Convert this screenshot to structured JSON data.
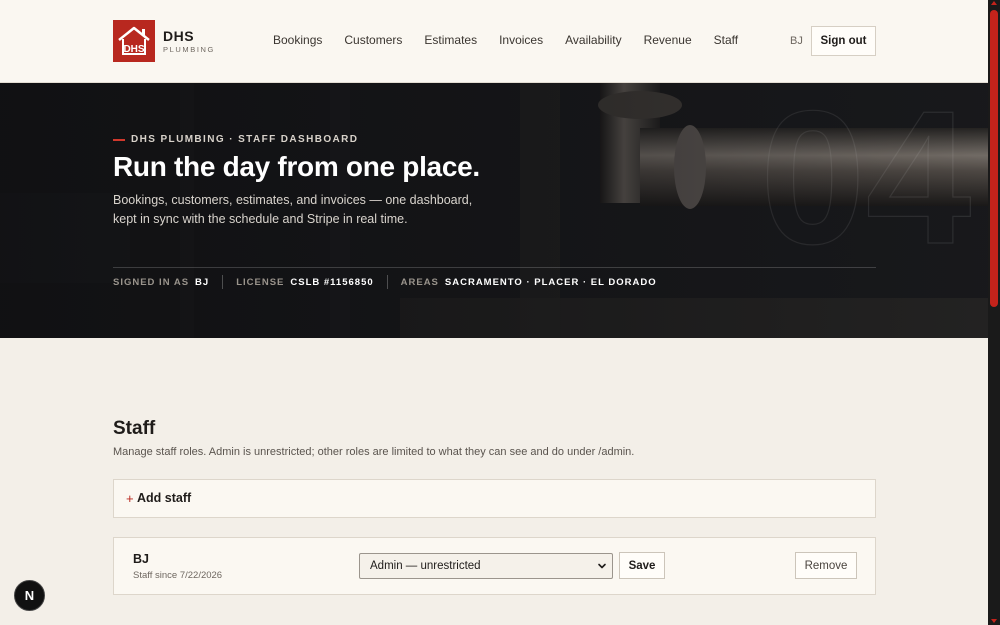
{
  "brand": {
    "name": "DHS",
    "subtitle": "PLUMBING",
    "logo_text": "DHS",
    "color": "#b8281f"
  },
  "nav": {
    "items": [
      {
        "label": "Bookings"
      },
      {
        "label": "Customers"
      },
      {
        "label": "Estimates"
      },
      {
        "label": "Invoices"
      },
      {
        "label": "Availability"
      },
      {
        "label": "Revenue"
      },
      {
        "label": "Staff"
      }
    ]
  },
  "header": {
    "user_initials": "BJ",
    "signout_label": "Sign out"
  },
  "hero": {
    "eyebrow": "DHS PLUMBING · STAFF DASHBOARD",
    "title": "Run the day from one place.",
    "description": "Bookings, customers, estimates, and invoices — one dashboard, kept in sync with the schedule and Stripe in real time.",
    "meta": {
      "signed_in_label": "SIGNED IN AS",
      "signed_in_value": "BJ",
      "license_label": "LICENSE",
      "license_value": "CSLB #1156850",
      "areas_label": "AREAS",
      "areas_value": "SACRAMENTO · PLACER · EL DORADO"
    }
  },
  "staff": {
    "title": "Staff",
    "description": "Manage staff roles. Admin is unrestricted; other roles are limited to what they can see and do under /admin.",
    "add_plus": "+",
    "add_label": "Add staff",
    "members": [
      {
        "name": "BJ",
        "since": "Staff since 7/22/2026",
        "role": "Admin — unrestricted",
        "save_label": "Save",
        "remove_label": "Remove"
      }
    ]
  },
  "dev_badge": {
    "letter": "N"
  },
  "colors": {
    "accent": "#b8281f",
    "background": "#f3efe8",
    "header_bg": "#faf7f1",
    "scroll_accent": "#c4231b"
  }
}
